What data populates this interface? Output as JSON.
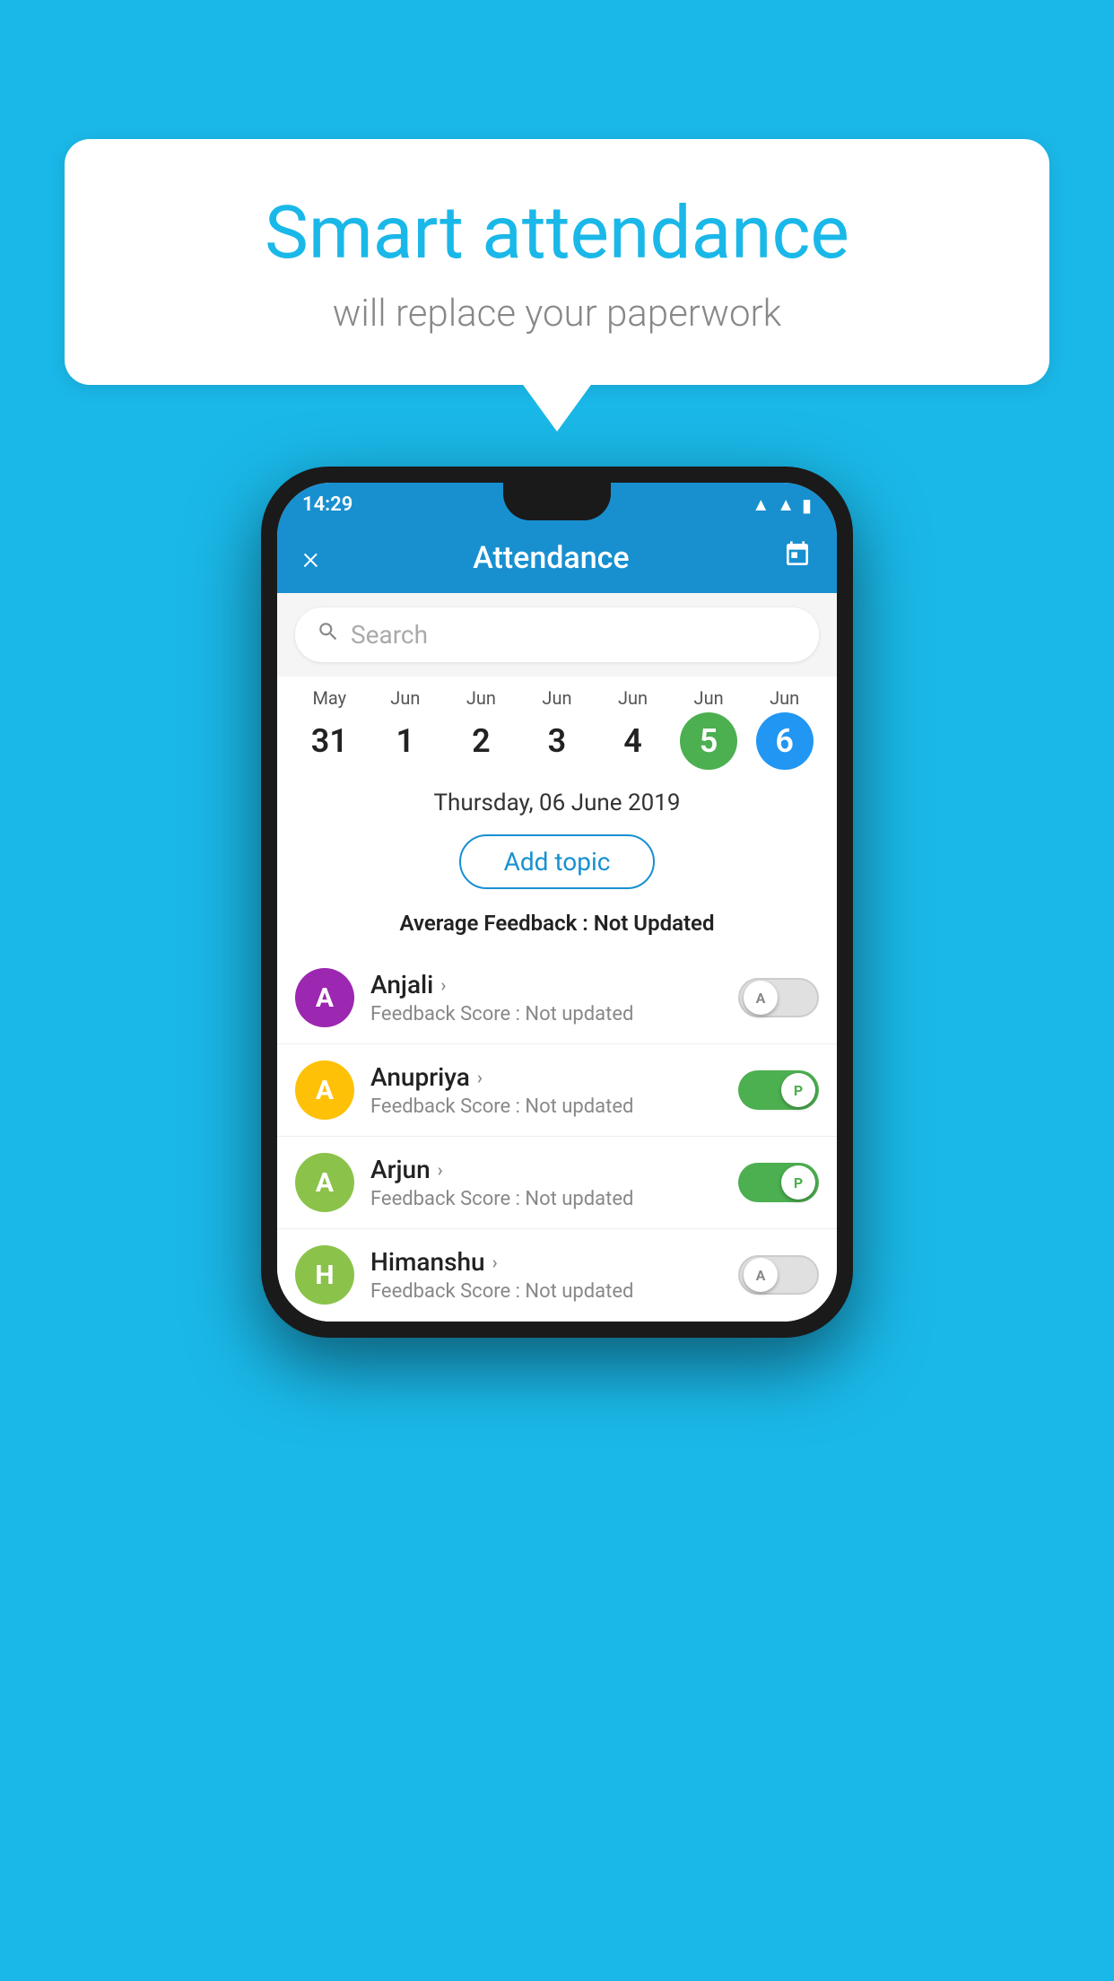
{
  "background_color": "#1AB8E8",
  "speech_bubble": {
    "title": "Smart attendance",
    "subtitle": "will replace your paperwork"
  },
  "status_bar": {
    "time": "14:29",
    "icons": [
      "wifi",
      "signal",
      "battery"
    ]
  },
  "app_bar": {
    "title": "Attendance",
    "close_label": "×",
    "calendar_icon": "calendar"
  },
  "search": {
    "placeholder": "Search"
  },
  "calendar": {
    "days": [
      {
        "month": "May",
        "date": "31",
        "highlight": "none"
      },
      {
        "month": "Jun",
        "date": "1",
        "highlight": "none"
      },
      {
        "month": "Jun",
        "date": "2",
        "highlight": "none"
      },
      {
        "month": "Jun",
        "date": "3",
        "highlight": "none"
      },
      {
        "month": "Jun",
        "date": "4",
        "highlight": "none"
      },
      {
        "month": "Jun",
        "date": "5",
        "highlight": "green"
      },
      {
        "month": "Jun",
        "date": "6",
        "highlight": "blue"
      }
    ],
    "selected_date": "Thursday, 06 June 2019"
  },
  "add_topic": {
    "label": "Add topic"
  },
  "average_feedback": {
    "label": "Average Feedback : ",
    "value": "Not Updated"
  },
  "students": [
    {
      "name": "Anjali",
      "avatar_letter": "A",
      "avatar_color": "#9C27B0",
      "feedback": "Feedback Score : Not updated",
      "status": "absent"
    },
    {
      "name": "Anupriya",
      "avatar_letter": "A",
      "avatar_color": "#FFC107",
      "feedback": "Feedback Score : Not updated",
      "status": "present"
    },
    {
      "name": "Arjun",
      "avatar_letter": "A",
      "avatar_color": "#8BC34A",
      "feedback": "Feedback Score : Not updated",
      "status": "present"
    },
    {
      "name": "Himanshu",
      "avatar_letter": "H",
      "avatar_color": "#8BC34A",
      "feedback": "Feedback Score : Not updated",
      "status": "absent"
    }
  ]
}
